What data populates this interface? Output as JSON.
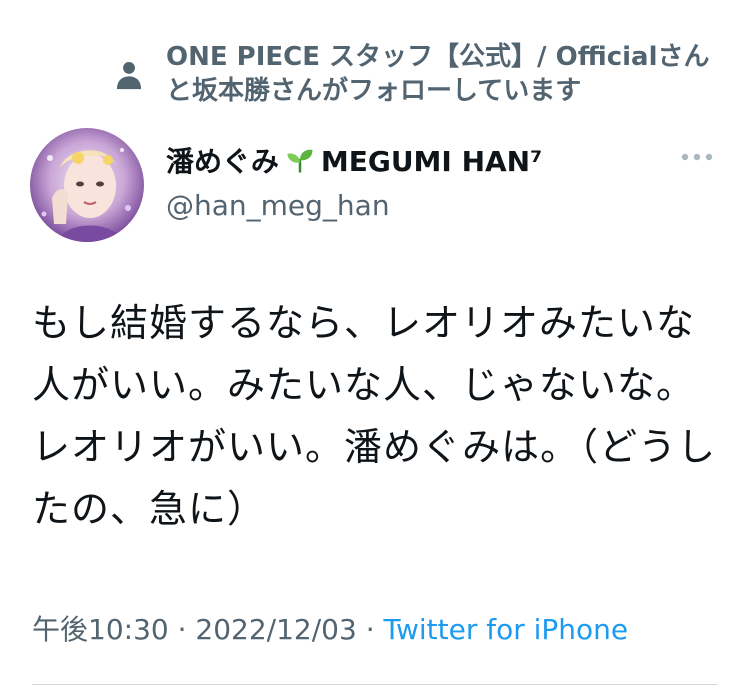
{
  "social_context": {
    "icon": "person-icon",
    "text": "ONE PIECE スタッフ【公式】/ Officialさんと坂本勝さんがフォローしています"
  },
  "author": {
    "display_name": "潘めぐみ",
    "display_name_suffix": "MEGUMI HAN⁷",
    "handle": "@han_meg_han",
    "avatar": "profile-photo"
  },
  "tweet": {
    "text": "もし結婚するなら、レオリオみたいな人がいい。みたいな人、じゃないな。レオリオがいい。潘めぐみは。（どうしたの、急に）"
  },
  "meta": {
    "time": "午後10:30",
    "separator": " · ",
    "date": "2022/12/03",
    "source": "Twitter for iPhone"
  },
  "colors": {
    "secondary_text": "#536471",
    "link": "#1d9bf0",
    "divider": "#cfd9de"
  }
}
